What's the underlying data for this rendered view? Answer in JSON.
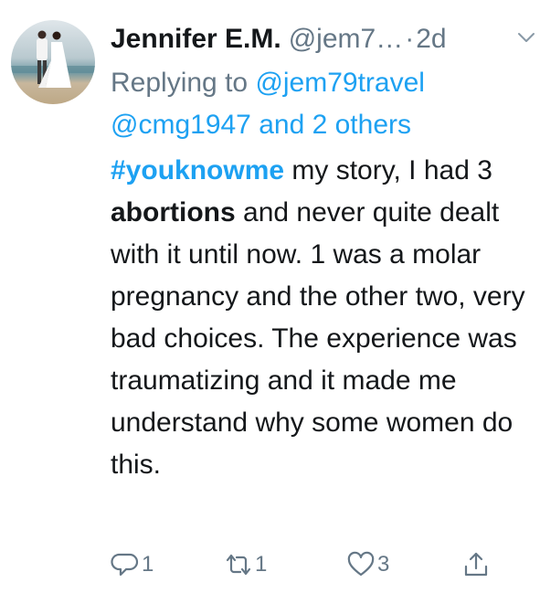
{
  "tweet": {
    "author_name": "Jennifer E.M.",
    "handle": "@jem7…",
    "separator": "·",
    "time": "2d",
    "replying_prefix": "Replying to ",
    "replying_to": [
      "@jem79travel",
      "@cmg1947"
    ],
    "replying_suffix": " and 2 others",
    "hashtag": "#youknowme",
    "body_part1": " my story, I had 3 ",
    "body_bold": "abortions",
    "body_part2": " and never quite dealt with it until now. 1 was a molar pregnancy and the other two, very bad choices.  The experience was traumatizing and  it made me understand why some women do this."
  },
  "actions": {
    "reply_count": "1",
    "retweet_count": "1",
    "like_count": "3",
    "share_count": ""
  },
  "colors": {
    "link": "#1da1f2",
    "muted": "#657786",
    "text": "#14171a"
  },
  "icons": [
    "avatar",
    "chevron-down-icon",
    "reply-icon",
    "retweet-icon",
    "like-icon",
    "share-icon"
  ]
}
